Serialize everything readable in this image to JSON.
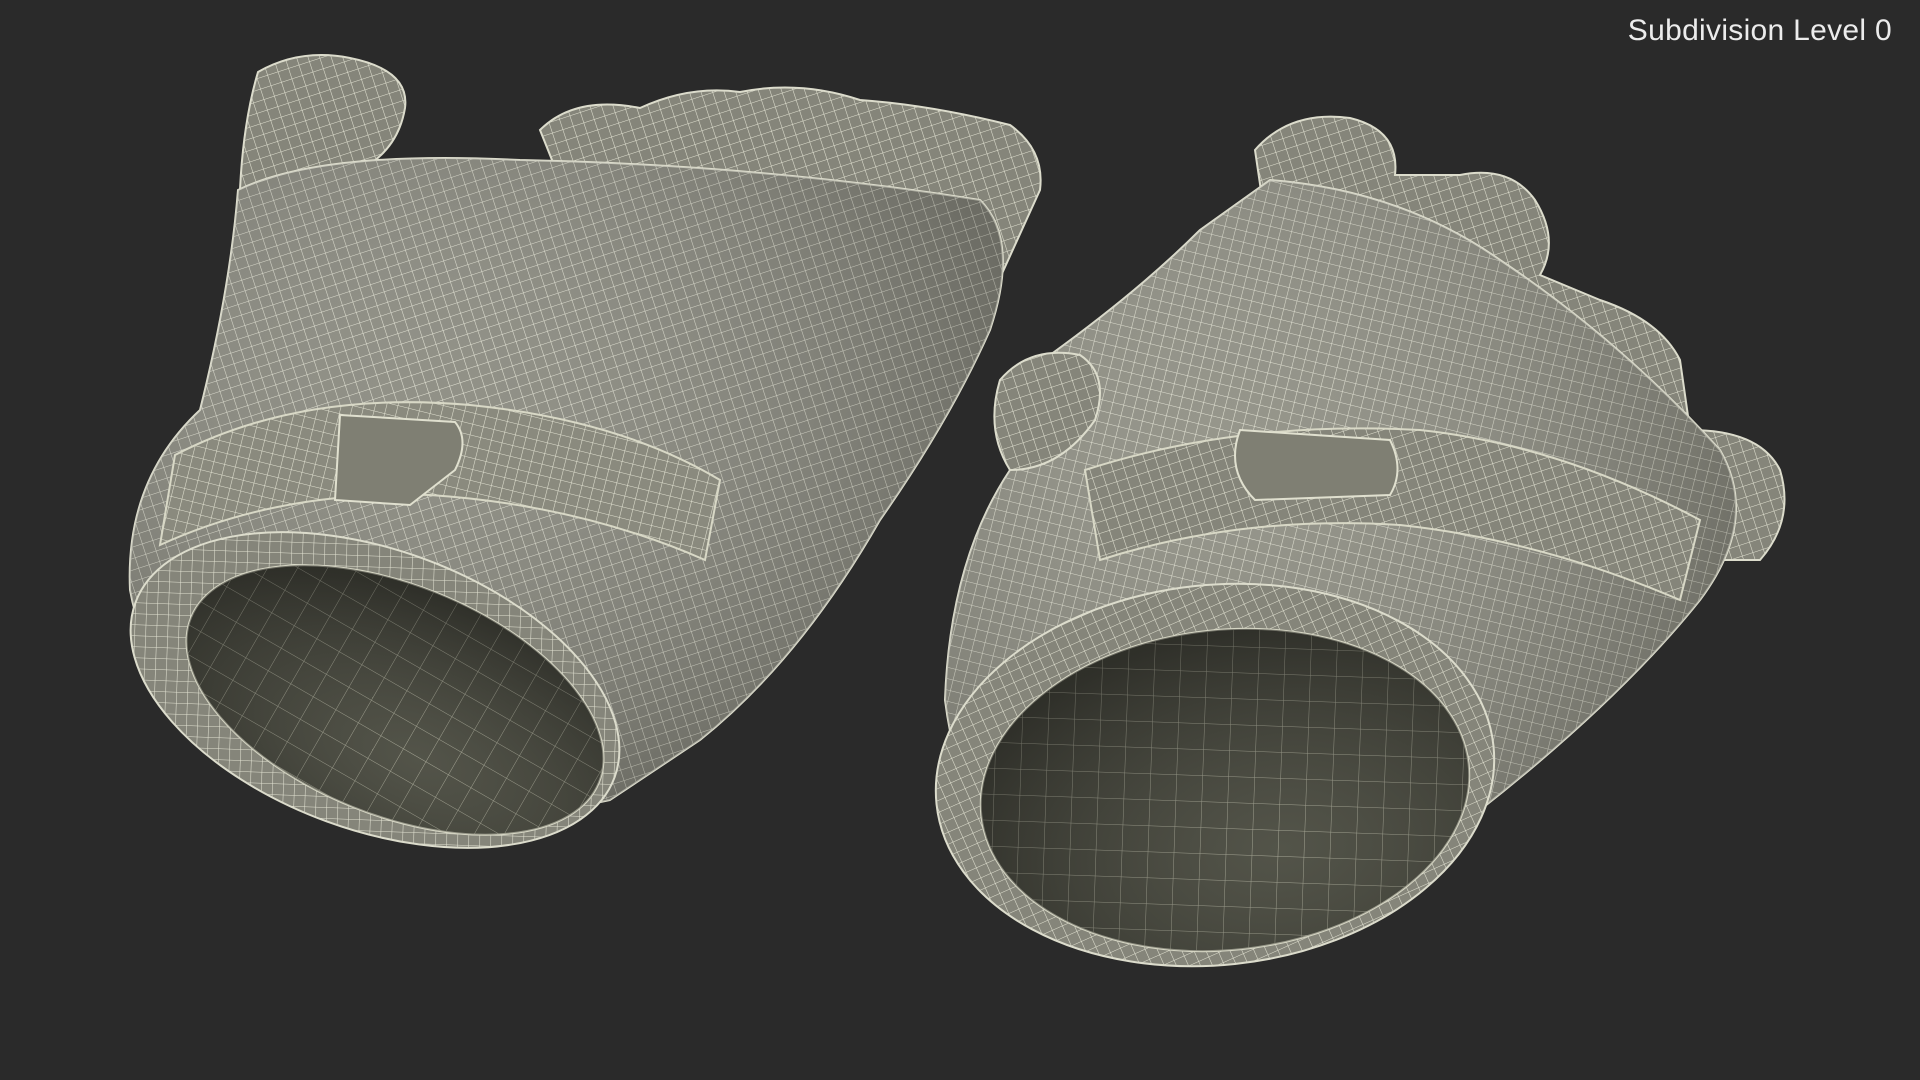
{
  "viewport": {
    "label": "Subdivision Level 0",
    "background": "#2a2a2a"
  },
  "render": {
    "surface_color": "#8a8a7c",
    "surface_shadow": "#55564c",
    "interior_color": "#3e3f37",
    "wire_color": "#e6e6d4"
  },
  "objects": [
    {
      "name": "left-glove",
      "kind": "fingerless glove wireframe"
    },
    {
      "name": "right-glove",
      "kind": "fingerless glove wireframe"
    }
  ]
}
